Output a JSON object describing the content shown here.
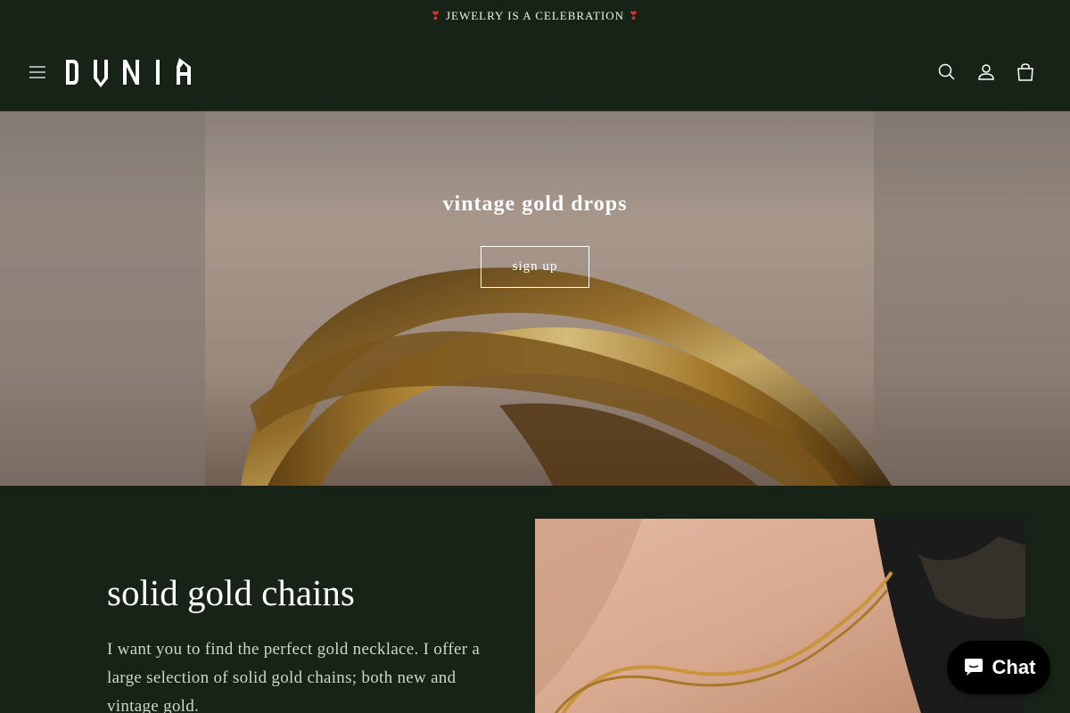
{
  "announcement": {
    "heart_left": "❣",
    "text": "JEWELRY IS A CELEBRATION",
    "heart_right": "❣"
  },
  "header": {
    "logo_text": "DUNIA",
    "menu_icon": "hamburger-icon",
    "search_icon": "search-icon",
    "account_icon": "user-icon",
    "cart_icon": "shopping-bag-icon"
  },
  "hero": {
    "title": "vintage gold drops",
    "button_label": "sign up"
  },
  "feature": {
    "title": "solid gold chains",
    "text": "I want you to find the perfect gold necklace. I offer a large selection of solid gold chains; both new and vintage gold."
  },
  "chat": {
    "label": "Chat",
    "icon": "chat-bubble-icon"
  },
  "colors": {
    "background": "#162316",
    "heart": "#e0302c",
    "gold": "#c99a3e"
  }
}
